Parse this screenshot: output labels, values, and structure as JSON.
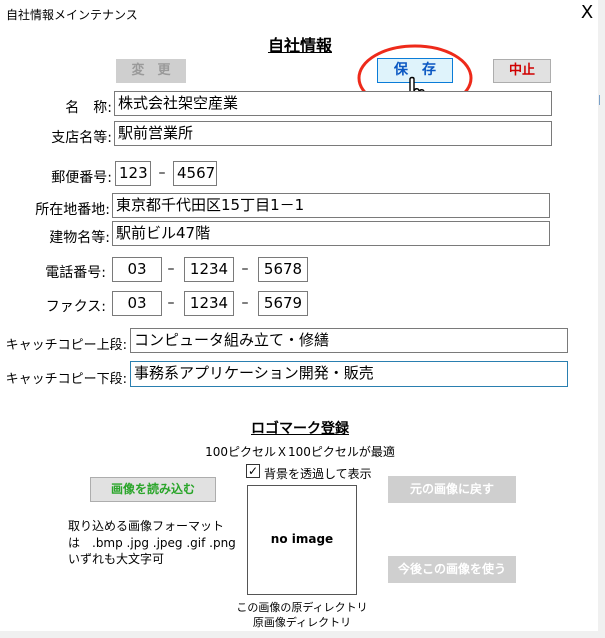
{
  "window": {
    "title": "自社情報メインテナンス",
    "close_glyph": "X"
  },
  "header": {
    "title": "自社情報"
  },
  "toolbar": {
    "change_label": "変　更",
    "save_label": "保　存",
    "cancel_label": "中止"
  },
  "form": {
    "name": {
      "label": "名　称:",
      "value": "株式会社架空産業"
    },
    "branch": {
      "label": "支店名等:",
      "value": "駅前営業所"
    },
    "postal": {
      "label": "郵便番号:",
      "part1": "123",
      "part2": "4567",
      "sep": "–"
    },
    "address": {
      "label": "所在地番地:",
      "value": "東京都千代田区15丁目1－1"
    },
    "building": {
      "label": "建物名等:",
      "value": "駅前ビル47階"
    },
    "phone": {
      "label": "電話番号:",
      "part1": "03",
      "part2": "1234",
      "part3": "5678",
      "sep": "–"
    },
    "fax": {
      "label": "ファクス:",
      "part1": "03",
      "part2": "1234",
      "part3": "5679",
      "sep": "–"
    },
    "catch_upper": {
      "label": "キャッチコピー上段:",
      "value": "コンピュータ組み立て・修繕"
    },
    "catch_lower": {
      "label": "キャッチコピー下段:",
      "value": "事務系アプリケーション開発・販売"
    }
  },
  "logo": {
    "title": "ロゴマーク登録",
    "size_note": "100ピクセルＸ100ピクセルが最適",
    "transparent_label": "背景を透過して表示",
    "transparent_checked": true,
    "load_button": "画像を読み込む",
    "format_line1": "取り込める画像フォーマット",
    "format_line2": "は　.bmp .jpg .jpeg .gif .png",
    "format_line3": "いずれも大文字可",
    "placeholder": "no image",
    "restore_button": "元の画像に戻す",
    "use_button": "今後この画像を使う",
    "original_dir_label": "この画像の原ディレクトリ",
    "original_dir_value": "原画像ディレクトリ"
  },
  "colors": {
    "save_bg": "#dff3fb",
    "save_border": "#0a7cd8",
    "save_text": "#0a57c2",
    "cancel_text": "#d00000",
    "load_text": "#2aa52a",
    "highlight_circle": "#ee2a1a",
    "focus_border": "#2a7fb0"
  }
}
